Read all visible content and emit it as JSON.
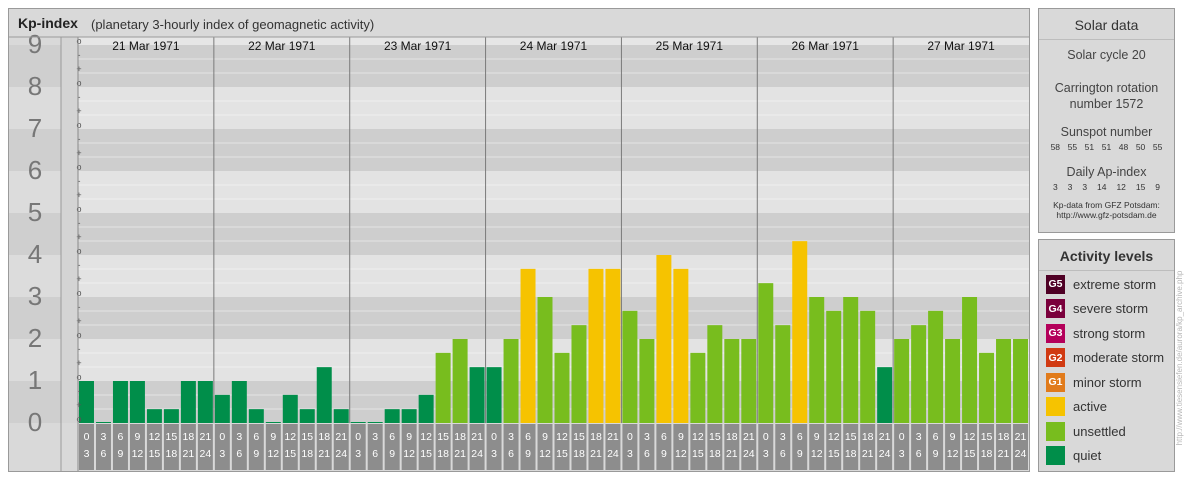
{
  "header": {
    "title": "Kp-index",
    "subtitle": "(planetary 3-hourly index of geomagnetic activity)"
  },
  "chart_data": {
    "type": "bar",
    "title": "Kp-index",
    "subtitle": "(planetary 3-hourly index of geomagnetic activity)",
    "ylim": [
      0,
      9
    ],
    "y_ticks": [
      "0",
      "1",
      "2",
      "3",
      "4",
      "5",
      "6",
      "7",
      "8",
      "9"
    ],
    "minor_ticks": [
      "o",
      "+",
      "-"
    ],
    "days": [
      "21 Mar 1971",
      "22 Mar 1971",
      "23 Mar 1971",
      "24 Mar 1971",
      "25 Mar 1971",
      "26 Mar 1971",
      "27 Mar 1971"
    ],
    "interval_labels": [
      [
        "0",
        "3"
      ],
      [
        "3",
        "6"
      ],
      [
        "6",
        "9"
      ],
      [
        "9",
        "12"
      ],
      [
        "12",
        "15"
      ],
      [
        "15",
        "18"
      ],
      [
        "18",
        "21"
      ],
      [
        "21",
        "24"
      ]
    ],
    "values": [
      1.0,
      0.0,
      1.0,
      1.0,
      0.33,
      0.33,
      1.0,
      1.0,
      0.67,
      1.0,
      0.33,
      0.0,
      0.67,
      0.33,
      1.33,
      0.33,
      0.0,
      0.0,
      0.33,
      0.33,
      0.67,
      1.67,
      2.0,
      1.33,
      1.33,
      2.0,
      3.67,
      3.0,
      1.67,
      2.33,
      3.67,
      3.67,
      2.67,
      2.0,
      4.0,
      3.67,
      1.67,
      2.33,
      2.0,
      2.0,
      3.33,
      2.33,
      4.33,
      3.0,
      2.67,
      3.0,
      2.67,
      1.33,
      2.0,
      2.33,
      2.67,
      2.0,
      3.0,
      1.67,
      2.0,
      2.0
    ],
    "colors": {
      "quiet": "#008e4a",
      "unsettled": "#78bd1e",
      "active": "#f6c300"
    }
  },
  "solar": {
    "title": "Solar data",
    "cycle": "Solar cycle 20",
    "carrington_line1": "Carrington rotation",
    "carrington_line2": "number 1572",
    "sunspot_label": "Sunspot number",
    "sunspot_values": [
      "58",
      "55",
      "51",
      "51",
      "48",
      "50",
      "55"
    ],
    "ap_label": "Daily Ap-index",
    "ap_values": [
      "3",
      "3",
      "3",
      "14",
      "12",
      "15",
      "9"
    ],
    "source_line1": "Kp-data from GFZ Potsdam:",
    "source_line2": "http://www.gfz-potsdam.de"
  },
  "activity": {
    "title": "Activity levels",
    "levels": [
      {
        "code": "G5",
        "label": "extreme storm",
        "color": "#4f0025"
      },
      {
        "code": "G4",
        "label": "severe storm",
        "color": "#7a003c"
      },
      {
        "code": "G3",
        "label": "strong storm",
        "color": "#b4005a"
      },
      {
        "code": "G2",
        "label": "moderate storm",
        "color": "#d13a12"
      },
      {
        "code": "G1",
        "label": "minor storm",
        "color": "#e17b1b"
      },
      {
        "code": "",
        "label": "active",
        "color": "#f6c300"
      },
      {
        "code": "",
        "label": "unsettled",
        "color": "#78bd1e"
      },
      {
        "code": "",
        "label": "quiet",
        "color": "#008e4a"
      }
    ]
  },
  "credit": "http://www.tiesensiefen.de/aurora/kp_archive.php"
}
